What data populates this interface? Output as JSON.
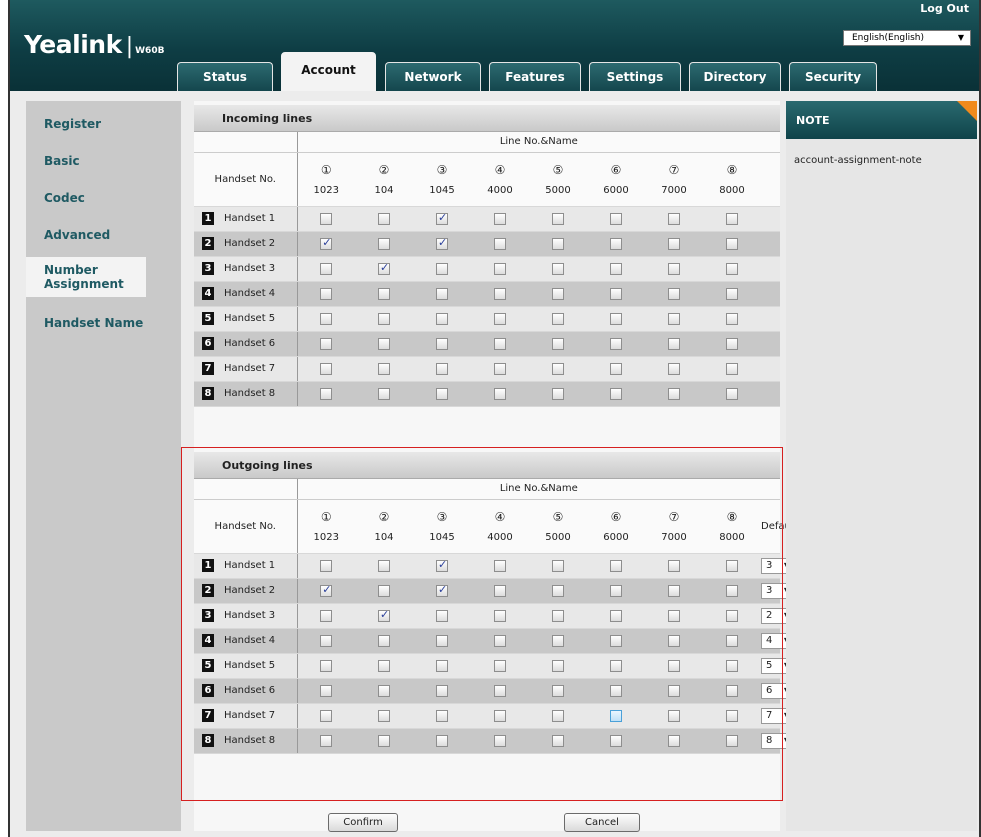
{
  "header": {
    "brand": "Yealink",
    "separator": "|",
    "model": "W60B",
    "logout_label": "Log Out",
    "language": "English(English)"
  },
  "tabs": [
    {
      "label": "Status"
    },
    {
      "label": "Account"
    },
    {
      "label": "Network"
    },
    {
      "label": "Features"
    },
    {
      "label": "Settings"
    },
    {
      "label": "Directory"
    },
    {
      "label": "Security"
    }
  ],
  "active_tab": "Account",
  "sidebar": {
    "items": [
      {
        "label": "Register"
      },
      {
        "label": "Basic"
      },
      {
        "label": "Codec"
      },
      {
        "label": "Advanced"
      },
      {
        "label": "Number Assignment"
      },
      {
        "label": "Handset Name"
      }
    ],
    "active": "Number Assignment"
  },
  "incoming": {
    "title": "Incoming lines",
    "line_header": "Line No.&Name",
    "handset_header": "Handset No.",
    "lines": [
      {
        "num": "①",
        "name": "1023"
      },
      {
        "num": "②",
        "name": "104"
      },
      {
        "num": "③",
        "name": "1045"
      },
      {
        "num": "④",
        "name": "4000"
      },
      {
        "num": "⑤",
        "name": "5000"
      },
      {
        "num": "⑥",
        "name": "6000"
      },
      {
        "num": "⑦",
        "name": "7000"
      },
      {
        "num": "⑧",
        "name": "8000"
      }
    ],
    "rows": [
      {
        "num": "1",
        "label": "Handset 1",
        "checked": [
          false,
          false,
          true,
          false,
          false,
          false,
          false,
          false
        ]
      },
      {
        "num": "2",
        "label": "Handset 2",
        "checked": [
          true,
          false,
          true,
          false,
          false,
          false,
          false,
          false
        ]
      },
      {
        "num": "3",
        "label": "Handset 3",
        "checked": [
          false,
          true,
          false,
          false,
          false,
          false,
          false,
          false
        ]
      },
      {
        "num": "4",
        "label": "Handset 4",
        "checked": [
          false,
          false,
          false,
          false,
          false,
          false,
          false,
          false
        ]
      },
      {
        "num": "5",
        "label": "Handset 5",
        "checked": [
          false,
          false,
          false,
          false,
          false,
          false,
          false,
          false
        ]
      },
      {
        "num": "6",
        "label": "Handset 6",
        "checked": [
          false,
          false,
          false,
          false,
          false,
          false,
          false,
          false
        ]
      },
      {
        "num": "7",
        "label": "Handset 7",
        "checked": [
          false,
          false,
          false,
          false,
          false,
          false,
          false,
          false
        ]
      },
      {
        "num": "8",
        "label": "Handset 8",
        "checked": [
          false,
          false,
          false,
          false,
          false,
          false,
          false,
          false
        ]
      }
    ]
  },
  "outgoing": {
    "title": "Outgoing lines",
    "line_header": "Line No.&Name",
    "handset_header": "Handset No.",
    "default_header": "Default",
    "lines": [
      {
        "num": "①",
        "name": "1023"
      },
      {
        "num": "②",
        "name": "104"
      },
      {
        "num": "③",
        "name": "1045"
      },
      {
        "num": "④",
        "name": "4000"
      },
      {
        "num": "⑤",
        "name": "5000"
      },
      {
        "num": "⑥",
        "name": "6000"
      },
      {
        "num": "⑦",
        "name": "7000"
      },
      {
        "num": "⑧",
        "name": "8000"
      }
    ],
    "rows": [
      {
        "num": "1",
        "label": "Handset 1",
        "checked": [
          false,
          false,
          true,
          false,
          false,
          false,
          false,
          false
        ],
        "default": "3"
      },
      {
        "num": "2",
        "label": "Handset 2",
        "checked": [
          true,
          false,
          true,
          false,
          false,
          false,
          false,
          false
        ],
        "default": "3"
      },
      {
        "num": "3",
        "label": "Handset 3",
        "checked": [
          false,
          true,
          false,
          false,
          false,
          false,
          false,
          false
        ],
        "default": "2"
      },
      {
        "num": "4",
        "label": "Handset 4",
        "checked": [
          false,
          false,
          false,
          false,
          false,
          false,
          false,
          false
        ],
        "default": "4"
      },
      {
        "num": "5",
        "label": "Handset 5",
        "checked": [
          false,
          false,
          false,
          false,
          false,
          false,
          false,
          false
        ],
        "default": "5"
      },
      {
        "num": "6",
        "label": "Handset 6",
        "checked": [
          false,
          false,
          false,
          false,
          false,
          false,
          false,
          false
        ],
        "default": "6"
      },
      {
        "num": "7",
        "label": "Handset 7",
        "checked": [
          false,
          false,
          false,
          false,
          false,
          true,
          false,
          false
        ],
        "default": "7",
        "highlight_col": 5
      },
      {
        "num": "8",
        "label": "Handset 8",
        "checked": [
          false,
          false,
          false,
          false,
          false,
          false,
          false,
          false
        ],
        "default": "8"
      }
    ]
  },
  "buttons": {
    "confirm": "Confirm",
    "cancel": "Cancel"
  },
  "note": {
    "title": "NOTE",
    "text": "account-assignment-note"
  }
}
